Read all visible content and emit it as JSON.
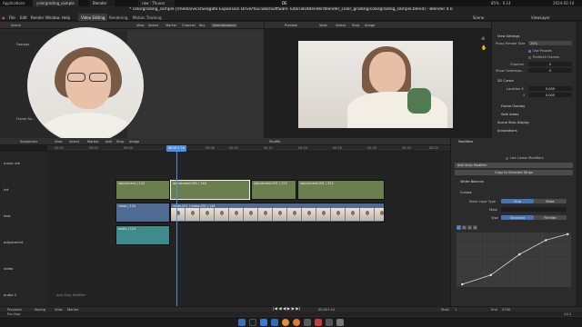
{
  "system_bar": {
    "applications": "Applications",
    "tabs": [
      "colorgrading_sample [/...",
      "Blender",
      "raw : Thunar"
    ],
    "right_time": "2024-02-14",
    "net": "85% · 0.14"
  },
  "title": "* colorgrading_sample [/media/vics/Seagate Expansion Drive/YouTube/Software Tutorials/Blender/blender_color_grading/colorgrading_sample.blend] - Blender 4.0",
  "menu": [
    "File",
    "Edit",
    "Render",
    "Window",
    "Help"
  ],
  "workspaces": [
    "Video Editing",
    "Rendering",
    "Motion Tracking"
  ],
  "scene": {
    "label": "Scene",
    "view_layer": "ViewLayer"
  },
  "top_left_header": [
    "View",
    "Select",
    "Marker",
    "Channel",
    "Key",
    "Normalization"
  ],
  "left_panel": {
    "scene_label": "Scene",
    "footage_label": "Footage",
    "frame_label": "Frame Ra..."
  },
  "preview_header": {
    "mode": "Preview",
    "items": [
      "View",
      "Select",
      "Strip",
      "Image"
    ]
  },
  "properties": {
    "view_settings": "View Settings",
    "proxy_render_size": "Proxy Render Size",
    "proxy_value": "25%",
    "use_proxies": "Use Proxies",
    "prefetch_frames": "Prefetch Frames",
    "channel_label": "Channel",
    "channel_value": "0",
    "show_overexposed": "Show Overexpo...",
    "show_overexposed_value": "0",
    "cursor_2d": "2D Cursor",
    "location_x": "Location X",
    "location_x_value": "0.000",
    "y": "Y",
    "y_value": "0.000",
    "frame_overlay": "Frame Overlay",
    "safe_areas": "Safe Areas",
    "scene_strip_display": "Scene Strip Display",
    "annotations": "Annotations"
  },
  "sequencer_header": {
    "mode": "Sequencer",
    "items": [
      "View",
      "Select",
      "Marker",
      "Add",
      "Strip",
      "Image"
    ],
    "shuffle": "Shuffle"
  },
  "current_frame": "00:00+ 14",
  "timeline_ticks": [
    "00:10",
    "00:02",
    "00:04",
    "00:06",
    "00:08",
    "00:10",
    "00:12",
    "00:14",
    "00:16",
    "00:18",
    "00:20",
    "00:22",
    "00:24"
  ],
  "channels": [
    {
      "name": "music sfx"
    },
    {
      "name": "txt"
    },
    {
      "name": "text"
    },
    {
      "name": "adjustment"
    },
    {
      "name": "video"
    },
    {
      "name": "audio 2"
    }
  ],
  "strips": {
    "adjust1": "adjustment | 124",
    "adjust2": "Adjustment.001 | 144",
    "adjust3": "adjustment.001 | 123",
    "adjust4": "adjustment.001 | 322",
    "video": "video | 124",
    "video2": "video.001 | video.002 | 144",
    "audio": "audio | 124"
  },
  "add_strip_modifier_bottom": "Add Strip Modifier",
  "modifiers_panel": {
    "header": "Modifiers",
    "use_linear": "Use Linear Modifiers",
    "add_strip_modifier": "Add Strip Modifier",
    "copy_to_selected": "Copy to Selected Strips",
    "white_balance": "White Balance",
    "curves": "Curves",
    "mask_input_type": "Mask Input Type",
    "strip_btn": "Strip",
    "mask_btn": "Mask",
    "mask_label": "Mask",
    "type_label": "Type",
    "standard": "Standard",
    "film_like": "Filmlike",
    "curve_channels": [
      "C",
      "R",
      "G",
      "B"
    ],
    "curve_points": [
      [
        0.05,
        0.05
      ],
      [
        0.3,
        0.22
      ],
      [
        0.55,
        0.6
      ],
      [
        0.78,
        0.86
      ],
      [
        0.97,
        0.97
      ]
    ]
  },
  "bottom_bar": {
    "playback": "Playback",
    "keying": "Keying",
    "view": "View",
    "marker": "Marker",
    "start": "Start",
    "start_val": "1",
    "end": "End",
    "end_val": "2700",
    "frame": "00:00+14"
  },
  "status": {
    "pan_view": "Pan View",
    "version": "4.0.2"
  },
  "colors": {
    "adjust_strip": "#6b7f4e",
    "video_strip": "#4f6a93",
    "audio_strip": "#3f8a8a",
    "accent": "#4772b3",
    "playhead": "#4a90e2"
  }
}
